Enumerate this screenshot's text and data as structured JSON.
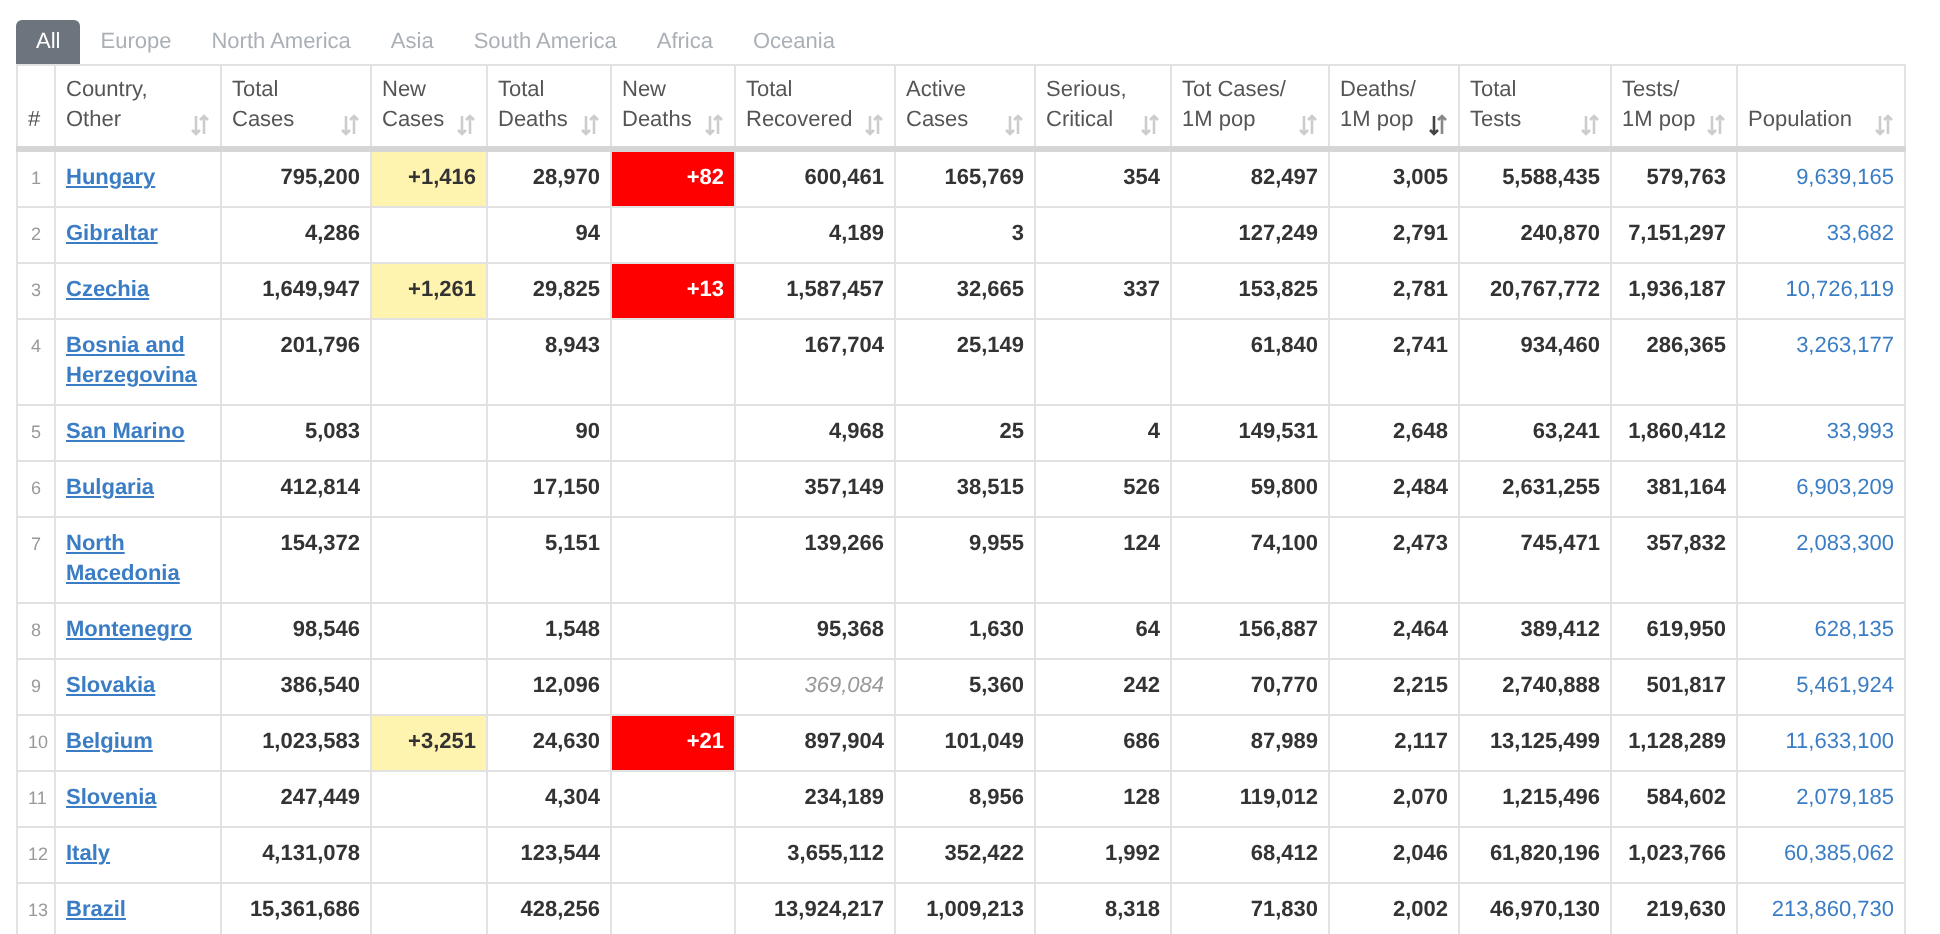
{
  "tabs": [
    {
      "label": "All",
      "selected": true
    },
    {
      "label": "Europe",
      "selected": false
    },
    {
      "label": "North America",
      "selected": false
    },
    {
      "label": "Asia",
      "selected": false
    },
    {
      "label": "South America",
      "selected": false
    },
    {
      "label": "Africa",
      "selected": false
    },
    {
      "label": "Oceania",
      "selected": false
    }
  ],
  "table": {
    "columns": [
      {
        "label": "#"
      },
      {
        "label": "Country,\nOther",
        "sorted": false
      },
      {
        "label": "Total\nCases",
        "sorted": false
      },
      {
        "label": "New\nCases",
        "sorted": false
      },
      {
        "label": "Total\nDeaths",
        "sorted": false
      },
      {
        "label": "New\nDeaths",
        "sorted": false
      },
      {
        "label": "Total\nRecovered",
        "sorted": false
      },
      {
        "label": "Active\nCases",
        "sorted": false
      },
      {
        "label": "Serious,\nCritical",
        "sorted": false
      },
      {
        "label": "Tot Cases/\n1M pop",
        "sorted": false
      },
      {
        "label": "Deaths/\n1M pop",
        "sorted": true
      },
      {
        "label": "Total\nTests",
        "sorted": false
      },
      {
        "label": "Tests/\n1M pop",
        "sorted": false
      },
      {
        "label": "Population",
        "sorted": false
      }
    ],
    "rows": [
      {
        "rank": "1",
        "country": "Hungary",
        "total_cases": "795,200",
        "new_cases": "+1,416",
        "total_deaths": "28,970",
        "new_deaths": "+82",
        "total_recovered": "600,461",
        "recovered_estimated": false,
        "active_cases": "165,769",
        "serious_critical": "354",
        "tot_cases_per_1m": "82,497",
        "deaths_per_1m": "3,005",
        "total_tests": "5,588,435",
        "tests_per_1m": "579,763",
        "population": "9,639,165"
      },
      {
        "rank": "2",
        "country": "Gibraltar",
        "total_cases": "4,286",
        "total_deaths": "94",
        "total_recovered": "4,189",
        "recovered_estimated": false,
        "active_cases": "3",
        "tot_cases_per_1m": "127,249",
        "deaths_per_1m": "2,791",
        "total_tests": "240,870",
        "tests_per_1m": "7,151,297",
        "population": "33,682"
      },
      {
        "rank": "3",
        "country": "Czechia",
        "total_cases": "1,649,947",
        "new_cases": "+1,261",
        "total_deaths": "29,825",
        "new_deaths": "+13",
        "total_recovered": "1,587,457",
        "recovered_estimated": false,
        "active_cases": "32,665",
        "serious_critical": "337",
        "tot_cases_per_1m": "153,825",
        "deaths_per_1m": "2,781",
        "total_tests": "20,767,772",
        "tests_per_1m": "1,936,187",
        "population": "10,726,119"
      },
      {
        "rank": "4",
        "country": "Bosnia and Herzegovina",
        "total_cases": "201,796",
        "total_deaths": "8,943",
        "total_recovered": "167,704",
        "recovered_estimated": false,
        "active_cases": "25,149",
        "tot_cases_per_1m": "61,840",
        "deaths_per_1m": "2,741",
        "total_tests": "934,460",
        "tests_per_1m": "286,365",
        "population": "3,263,177"
      },
      {
        "rank": "5",
        "country": "San Marino",
        "total_cases": "5,083",
        "total_deaths": "90",
        "total_recovered": "4,968",
        "recovered_estimated": false,
        "active_cases": "25",
        "serious_critical": "4",
        "tot_cases_per_1m": "149,531",
        "deaths_per_1m": "2,648",
        "total_tests": "63,241",
        "tests_per_1m": "1,860,412",
        "population": "33,993"
      },
      {
        "rank": "6",
        "country": "Bulgaria",
        "total_cases": "412,814",
        "total_deaths": "17,150",
        "total_recovered": "357,149",
        "recovered_estimated": false,
        "active_cases": "38,515",
        "serious_critical": "526",
        "tot_cases_per_1m": "59,800",
        "deaths_per_1m": "2,484",
        "total_tests": "2,631,255",
        "tests_per_1m": "381,164",
        "population": "6,903,209"
      },
      {
        "rank": "7",
        "country": "North Macedonia",
        "total_cases": "154,372",
        "total_deaths": "5,151",
        "total_recovered": "139,266",
        "recovered_estimated": false,
        "active_cases": "9,955",
        "serious_critical": "124",
        "tot_cases_per_1m": "74,100",
        "deaths_per_1m": "2,473",
        "total_tests": "745,471",
        "tests_per_1m": "357,832",
        "population": "2,083,300"
      },
      {
        "rank": "8",
        "country": "Montenegro",
        "total_cases": "98,546",
        "total_deaths": "1,548",
        "total_recovered": "95,368",
        "recovered_estimated": false,
        "active_cases": "1,630",
        "serious_critical": "64",
        "tot_cases_per_1m": "156,887",
        "deaths_per_1m": "2,464",
        "total_tests": "389,412",
        "tests_per_1m": "619,950",
        "population": "628,135"
      },
      {
        "rank": "9",
        "country": "Slovakia",
        "total_cases": "386,540",
        "total_deaths": "12,096",
        "total_recovered": "369,084",
        "recovered_estimated": true,
        "active_cases": "5,360",
        "serious_critical": "242",
        "tot_cases_per_1m": "70,770",
        "deaths_per_1m": "2,215",
        "total_tests": "2,740,888",
        "tests_per_1m": "501,817",
        "population": "5,461,924"
      },
      {
        "rank": "10",
        "country": "Belgium",
        "total_cases": "1,023,583",
        "new_cases": "+3,251",
        "total_deaths": "24,630",
        "new_deaths": "+21",
        "total_recovered": "897,904",
        "recovered_estimated": false,
        "active_cases": "101,049",
        "serious_critical": "686",
        "tot_cases_per_1m": "87,989",
        "deaths_per_1m": "2,117",
        "total_tests": "13,125,499",
        "tests_per_1m": "1,128,289",
        "population": "11,633,100"
      },
      {
        "rank": "11",
        "country": "Slovenia",
        "total_cases": "247,449",
        "total_deaths": "4,304",
        "total_recovered": "234,189",
        "recovered_estimated": false,
        "active_cases": "8,956",
        "serious_critical": "128",
        "tot_cases_per_1m": "119,012",
        "deaths_per_1m": "2,070",
        "total_tests": "1,215,496",
        "tests_per_1m": "584,602",
        "population": "2,079,185"
      },
      {
        "rank": "12",
        "country": "Italy",
        "total_cases": "4,131,078",
        "total_deaths": "123,544",
        "total_recovered": "3,655,112",
        "recovered_estimated": false,
        "active_cases": "352,422",
        "serious_critical": "1,992",
        "tot_cases_per_1m": "68,412",
        "deaths_per_1m": "2,046",
        "total_tests": "61,820,196",
        "tests_per_1m": "1,023,766",
        "population": "60,385,062"
      },
      {
        "rank": "13",
        "country": "Brazil",
        "total_cases": "15,361,686",
        "total_deaths": "428,256",
        "total_recovered": "13,924,217",
        "recovered_estimated": false,
        "active_cases": "1,009,213",
        "serious_critical": "8,318",
        "tot_cases_per_1m": "71,830",
        "deaths_per_1m": "2,002",
        "total_tests": "46,970,130",
        "tests_per_1m": "219,630",
        "population": "213,860,730"
      }
    ]
  }
}
